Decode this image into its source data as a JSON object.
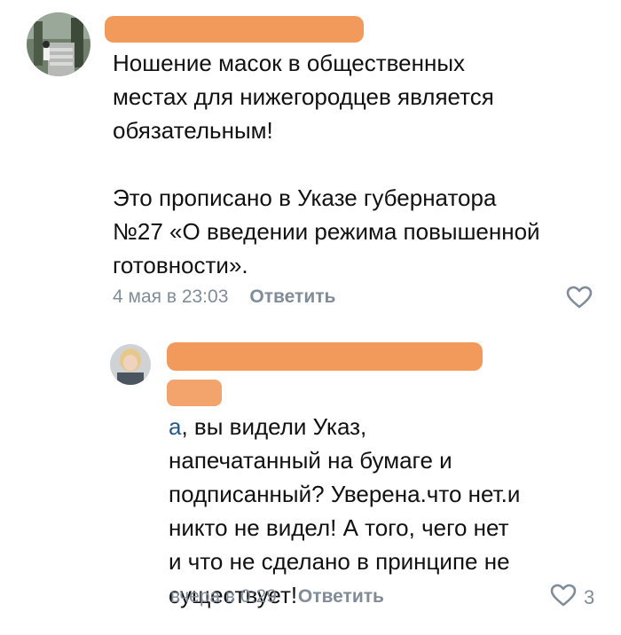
{
  "comments": [
    {
      "text": "Ношение масок в общественных\nместах для нижегородцев является\nобязательным!\n\nЭто прописано в Указе губернатора\n№27 «О введении режима повышенной\nготовности».",
      "date": "4 мая в 23:03",
      "reply_label": "Ответить",
      "likes": ""
    },
    {
      "mention": "а",
      "text": ", вы видели Указ,\nнапечатанный на бумаге и\nподписанный? Уверена.что нет.и\nникто не видел! А того, чего нет\nи что не сделано в принципе не\nсуществует!",
      "date": "вчера в 0:29",
      "reply_label": "Ответить",
      "likes": "3"
    }
  ],
  "icons": {
    "like": "heart-icon"
  },
  "colors": {
    "redaction": "#f29a5c",
    "meta": "#818c99",
    "mention": "#2a5885"
  }
}
